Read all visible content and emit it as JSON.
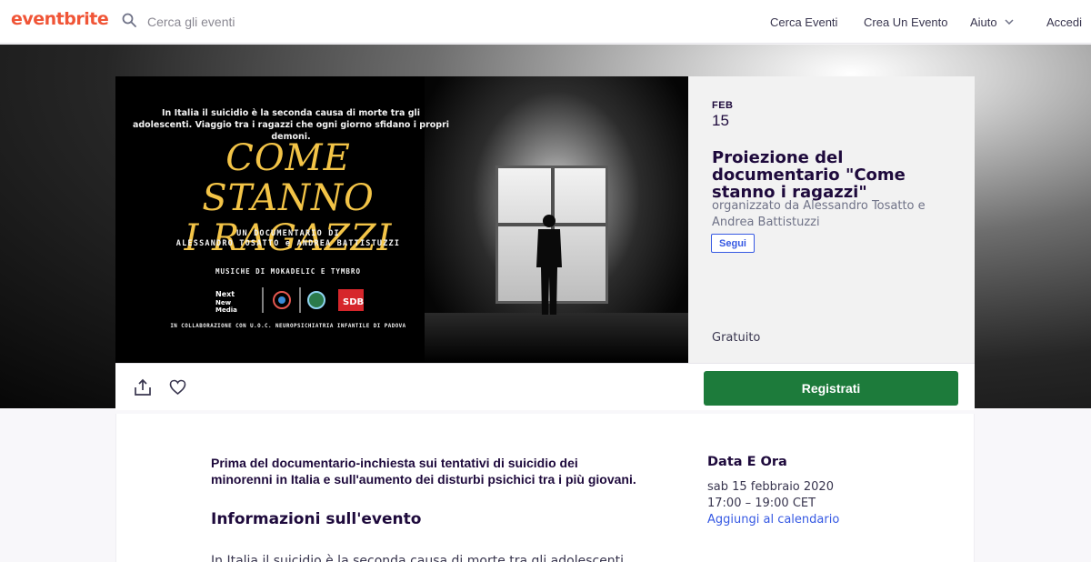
{
  "header": {
    "logo": "eventbrite",
    "search_placeholder": "Cerca gli eventi",
    "nav": {
      "cerca_eventi": "Cerca Eventi",
      "crea_evento": "Crea Un Evento",
      "aiuto": "Aiuto",
      "accedi": "Accedi"
    }
  },
  "poster": {
    "intro": "In Italia il suicidio è la seconda causa di morte tra gli adolescenti. Viaggio tra i ragazzi che ogni giorno sfidano i propri demoni.",
    "title_line1": "COME STANNO",
    "title_line2": "I RAGAZZI",
    "doc_line1": "UN DOCUMENTARIO DI",
    "doc_line2": "ALESSANDRO TOSATTO e ANDREA BATTISTUZZI",
    "music": "MUSICHE DI MOKADELIC E TYMBRO",
    "logo_text1": "Next",
    "logo_text2": "New",
    "logo_text3": "Media",
    "logo_text4": "SDB",
    "collab": "IN COLLABORAZIONE CON U.O.C. NEUROPSICHIATRIA INFANTILE DI PADOVA"
  },
  "event": {
    "month": "FEB",
    "day": "15",
    "title": "Proiezione del documentario \"Come stanno i ragazzi\"",
    "organizer": "organizzato da Alessandro Tosatto e Andrea Battistuzzi",
    "follow_label": "Segui",
    "price": "Gratuito",
    "register_label": "Registrati"
  },
  "details": {
    "summary": "Prima del documentario-inchiesta sui tentativi di suicidio dei minorenni in Italia e sull'aumento dei disturbi psichici tra i più giovani.",
    "about_title": "Informazioni sull'evento",
    "about_text": "In Italia il suicidio è la seconda causa di morte tra gli adolescenti",
    "datetime_title": "Data E Ora",
    "date": "sab 15 febbraio 2020",
    "time": "17:00 – 19:00 CET",
    "add_calendar": "Aggiungi al calendario"
  },
  "colors": {
    "brand": "#f05537",
    "register": "#1d7b3b",
    "link": "#3659e3",
    "poster_title": "#f3c447"
  }
}
